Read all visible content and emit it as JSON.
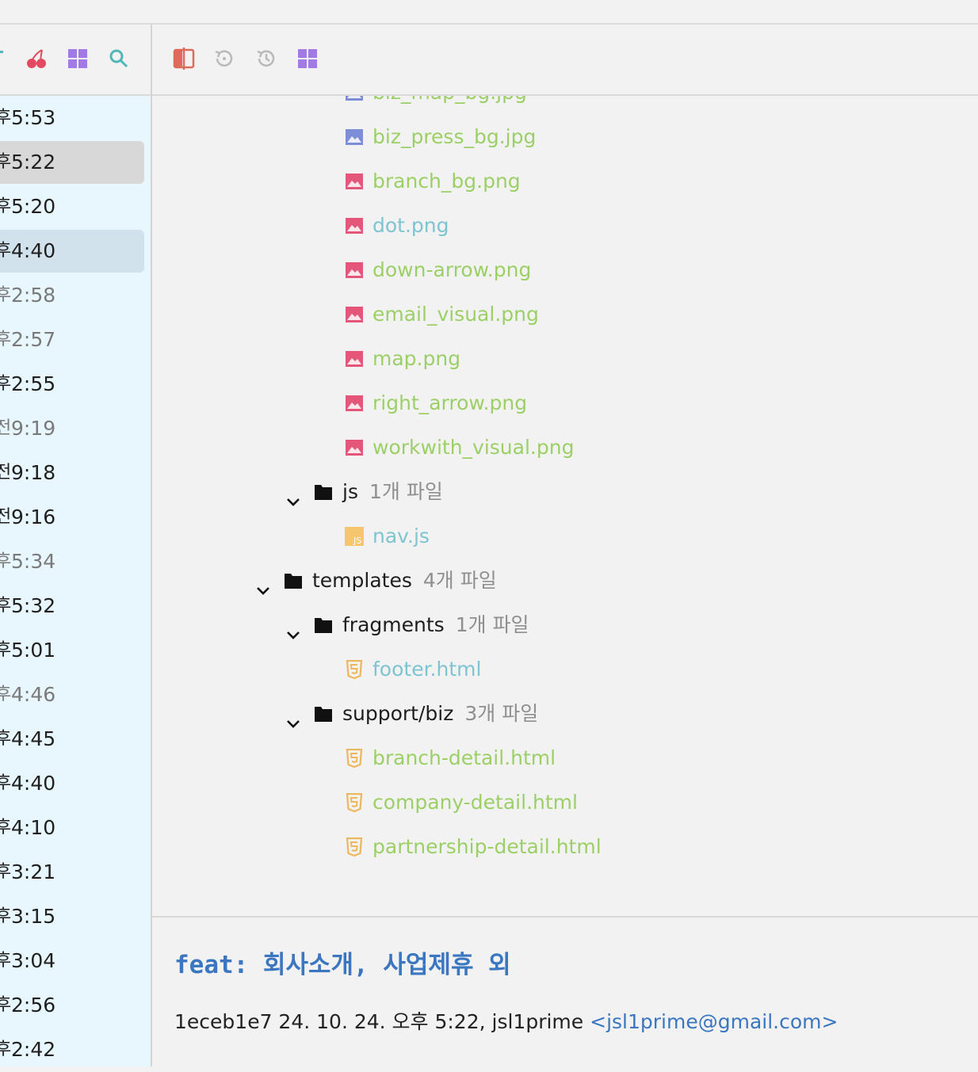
{
  "colors": {
    "added_file": "#9cd067",
    "modified_file": "#7fc4d1",
    "png_icon": "#e4577a",
    "jpg_icon": "#7d8ed9",
    "html_icon": "#ecb85b",
    "js_icon": "#f6c66d",
    "link": "#3a77c0"
  },
  "left_toolbar": {
    "icons": [
      "refresh-icon",
      "cherry-pick-icon",
      "grid-icon",
      "search-icon"
    ]
  },
  "right_toolbar": {
    "icons": [
      "compare-icon",
      "revert-icon",
      "history-icon",
      "grid-icon"
    ]
  },
  "commit_list": [
    {
      "ampm": "후",
      "time": "5:53",
      "state": "normal"
    },
    {
      "ampm": "후",
      "time": "5:22",
      "state": "selected"
    },
    {
      "ampm": "후",
      "time": "5:20",
      "state": "normal"
    },
    {
      "ampm": "후",
      "time": "4:40",
      "state": "hover"
    },
    {
      "ampm": "후",
      "time": "2:58",
      "state": "dim"
    },
    {
      "ampm": "후",
      "time": "2:57",
      "state": "dim"
    },
    {
      "ampm": "후",
      "time": "2:55",
      "state": "normal"
    },
    {
      "ampm": "전",
      "time": "9:19",
      "state": "dim"
    },
    {
      "ampm": "전",
      "time": "9:18",
      "state": "normal"
    },
    {
      "ampm": "전",
      "time": "9:16",
      "state": "normal"
    },
    {
      "ampm": "후",
      "time": "5:34",
      "state": "dim"
    },
    {
      "ampm": "후",
      "time": "5:32",
      "state": "normal"
    },
    {
      "ampm": "후",
      "time": "5:01",
      "state": "normal"
    },
    {
      "ampm": "후",
      "time": "4:46",
      "state": "dim"
    },
    {
      "ampm": "후",
      "time": "4:45",
      "state": "normal"
    },
    {
      "ampm": "후",
      "time": "4:40",
      "state": "normal"
    },
    {
      "ampm": "후",
      "time": "4:10",
      "state": "normal"
    },
    {
      "ampm": "후",
      "time": "3:21",
      "state": "normal"
    },
    {
      "ampm": "후",
      "time": "3:15",
      "state": "normal"
    },
    {
      "ampm": "후",
      "time": "3:04",
      "state": "normal"
    },
    {
      "ampm": "후",
      "time": "2:56",
      "state": "normal"
    },
    {
      "ampm": "후",
      "time": "2:42",
      "state": "normal"
    }
  ],
  "file_tree": [
    {
      "kind": "file",
      "name": "biz_map_bg.jpg",
      "icon": "jpg",
      "status": "added",
      "depth": 3
    },
    {
      "kind": "file",
      "name": "biz_press_bg.jpg",
      "icon": "jpg",
      "status": "added",
      "depth": 3
    },
    {
      "kind": "file",
      "name": "branch_bg.png",
      "icon": "png",
      "status": "added",
      "depth": 3
    },
    {
      "kind": "file",
      "name": "dot.png",
      "icon": "png",
      "status": "modified",
      "depth": 3
    },
    {
      "kind": "file",
      "name": "down-arrow.png",
      "icon": "png",
      "status": "added",
      "depth": 3
    },
    {
      "kind": "file",
      "name": "email_visual.png",
      "icon": "png",
      "status": "added",
      "depth": 3
    },
    {
      "kind": "file",
      "name": "map.png",
      "icon": "png",
      "status": "added",
      "depth": 3
    },
    {
      "kind": "file",
      "name": "right_arrow.png",
      "icon": "png",
      "status": "added",
      "depth": 3
    },
    {
      "kind": "file",
      "name": "workwith_visual.png",
      "icon": "png",
      "status": "added",
      "depth": 3
    },
    {
      "kind": "folder",
      "name": "js",
      "count": "1개 파일",
      "depth": 2
    },
    {
      "kind": "file",
      "name": "nav.js",
      "icon": "js",
      "status": "modified",
      "depth": 3
    },
    {
      "kind": "folder",
      "name": "templates",
      "count": "4개 파일",
      "depth": 1
    },
    {
      "kind": "folder",
      "name": "fragments",
      "count": "1개 파일",
      "depth": 2
    },
    {
      "kind": "file",
      "name": "footer.html",
      "icon": "html",
      "status": "modified",
      "depth": 3
    },
    {
      "kind": "folder",
      "name": "support/biz",
      "count": "3개 파일",
      "depth": 2
    },
    {
      "kind": "file",
      "name": "branch-detail.html",
      "icon": "html",
      "status": "added",
      "depth": 3
    },
    {
      "kind": "file",
      "name": "company-detail.html",
      "icon": "html",
      "status": "added",
      "depth": 3
    },
    {
      "kind": "file",
      "name": "partnership-detail.html",
      "icon": "html",
      "status": "added",
      "depth": 3
    }
  ],
  "commit_message": {
    "title": "feat: 회사소개, 사업제휴 외",
    "meta": "1eceb1e7 24. 10. 24. 오후 5:22, jsl1prime ",
    "email": "<jsl1prime@gmail.com>"
  }
}
